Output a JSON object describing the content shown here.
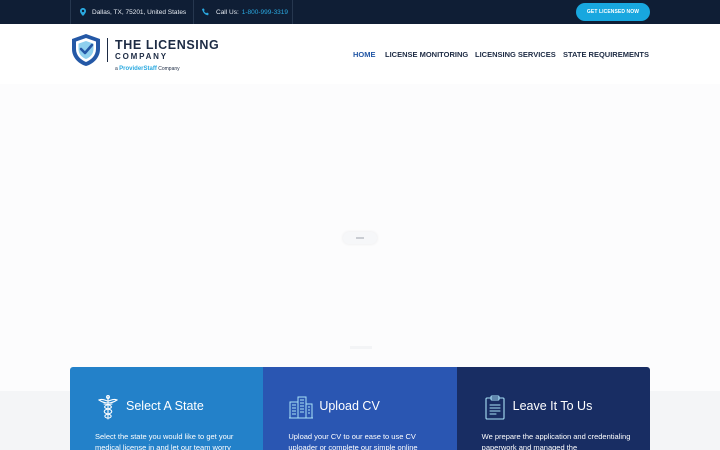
{
  "topbar": {
    "address": "Dallas, TX, 75201, United States",
    "call_label": "Call Us:",
    "phone": "1-800-999-3319",
    "cta_label": "GET LICENSED NOW",
    "icons": [
      "map-pin-icon",
      "phone-icon"
    ]
  },
  "logo": {
    "line1": "THE LICENSING",
    "line2": "COMPANY",
    "tag_prefix": "a",
    "tag_brand": "ProviderStaff",
    "tag_suffix": "Company"
  },
  "nav": {
    "items": [
      {
        "label": "HOME",
        "active": true
      },
      {
        "label": "LICENSE MONITORING",
        "active": false
      },
      {
        "label": "LICENSING SERVICES",
        "active": false
      },
      {
        "label": "STATE REQUIREMENTS",
        "active": false
      }
    ]
  },
  "cards": [
    {
      "title": "Select A State",
      "text": "Select the state you would like to get your medical license in and let our team worry",
      "icon": "caduceus-icon",
      "color": "#2381c9"
    },
    {
      "title": "Upload CV",
      "text": "Upload your CV to our ease to use CV uploader or complete our simple online",
      "icon": "buildings-icon",
      "color": "#2a56b2"
    },
    {
      "title": "Leave It To Us",
      "text": "We prepare the application and credentialing paperwork and managed the",
      "icon": "clipboard-icon",
      "color": "#182d63"
    }
  ],
  "colors": {
    "topbar": "#0f1e35",
    "accent": "#18a7df",
    "nav_active": "#2458a6",
    "brand_dark": "#1d2b44"
  }
}
